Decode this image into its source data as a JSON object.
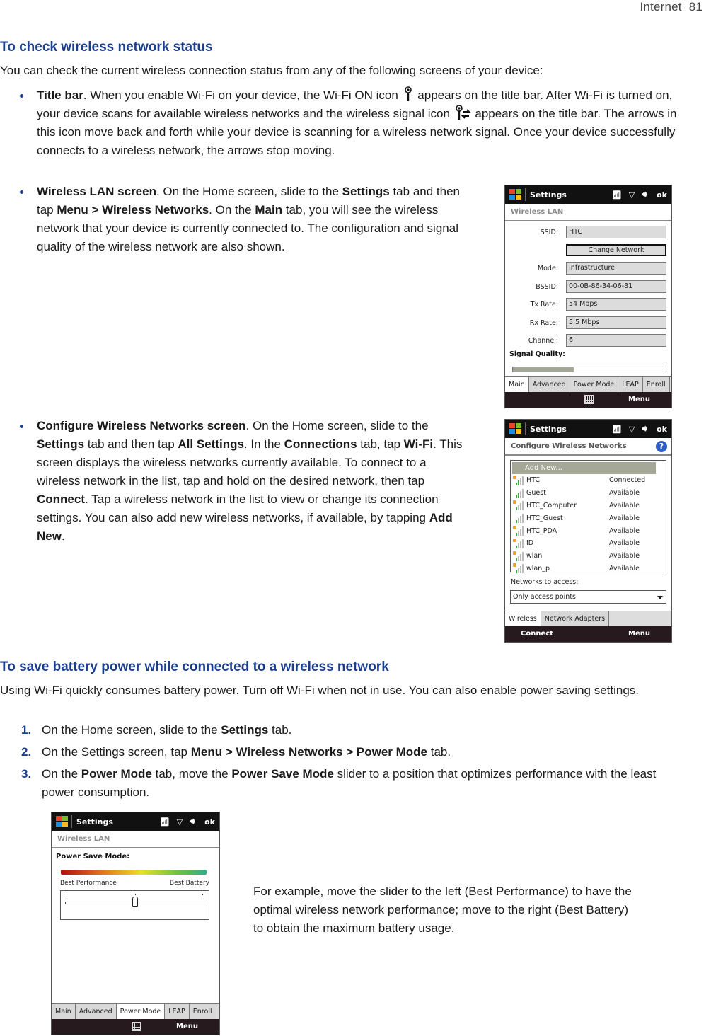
{
  "running_head": {
    "section": "Internet",
    "page": "81"
  },
  "section1": {
    "heading": "To check wireless network status",
    "intro": "You can check the current wireless connection status from any of the following screens of your device:",
    "bullets": [
      {
        "title": "Title bar",
        "text_a": ". When you enable Wi-Fi on your device, the Wi-Fi ON icon ",
        "text_b": " appears on the title bar. After Wi-Fi is turned on, your device scans for available wireless networks and the wireless signal icon ",
        "text_c": " appears on the title bar. The arrows in this icon move back and forth while your device is scanning for a wireless network signal. Once your device successfully connects to a wireless network, the arrows stop moving."
      },
      {
        "title": "Wireless LAN screen",
        "parts": [
          ". On the Home screen, slide to the ",
          "Settings",
          " tab and then tap ",
          "Menu > Wireless Networks",
          ". On the ",
          "Main",
          " tab, you will see the wireless network that your device is currently connected to. The configuration and signal quality of the wireless network are also shown."
        ]
      },
      {
        "title": "Configure Wireless Networks screen",
        "parts": [
          ". On the Home screen, slide to the ",
          "Settings",
          " tab and then tap ",
          "All Settings",
          ". In the ",
          "Connections",
          " tab, tap ",
          "Wi-Fi",
          ". This screen displays the wireless networks currently available. To connect to a wireless network in the list, tap and hold on the desired network, then tap ",
          "Connect",
          ". Tap a wireless network in the list to view or change its connection settings. You can also add new wireless networks, if available, by tapping ",
          "Add New",
          "."
        ]
      }
    ]
  },
  "section2": {
    "heading": "To save battery power while connected to a wireless network",
    "intro": "Using Wi-Fi quickly consumes battery power. Turn off Wi-Fi when not in use. You can also enable power saving settings.",
    "steps": [
      {
        "num": "1.",
        "parts": [
          "On the Home screen, slide to the ",
          "Settings",
          " tab."
        ]
      },
      {
        "num": "2.",
        "parts": [
          "On the Settings screen, tap ",
          "Menu > Wireless Networks > Power Mode",
          " tab."
        ]
      },
      {
        "num": "3.",
        "parts": [
          "On the ",
          "Power Mode",
          " tab, move the ",
          "Power Save Mode",
          " slider to a position that optimizes performance with the least power consumption."
        ]
      }
    ],
    "example": "For example, move the slider to the left (Best Performance) to have the optimal wireless network performance; move to the right (Best Battery) to obtain the maximum battery usage."
  },
  "phone_common": {
    "title": "Settings",
    "ok": "ok",
    "menu": "Menu",
    "icons": [
      "wifi-scan-icon",
      "signal-icon",
      "volume-icon"
    ]
  },
  "wlan_screen": {
    "subheader": "Wireless LAN",
    "fields": [
      {
        "label": "SSID:",
        "value": "HTC"
      },
      {
        "label": "Mode:",
        "value": "Infrastructure"
      },
      {
        "label": "BSSID:",
        "value": "00-0B-86-34-06-81"
      },
      {
        "label": "Tx Rate:",
        "value": "54 Mbps"
      },
      {
        "label": "Rx Rate:",
        "value": "5.5 Mbps"
      },
      {
        "label": "Channel:",
        "value": "6"
      }
    ],
    "change_network": "Change Network",
    "signal_label": "Signal Quality:",
    "signal_quality": 0.4,
    "tabs": [
      "Main",
      "Advanced",
      "Power Mode",
      "LEAP",
      "Enroll"
    ],
    "active_tab": "Main"
  },
  "cwn_screen": {
    "subheader": "Configure Wireless Networks",
    "add_new": "Add New...",
    "networks": [
      {
        "name": "HTC",
        "status": "Connected",
        "secured": true,
        "bars": 2
      },
      {
        "name": "Guest",
        "status": "Available",
        "secured": false,
        "bars": 2
      },
      {
        "name": "HTC_Computer",
        "status": "Available",
        "secured": true,
        "bars": 1
      },
      {
        "name": "HTC_Guest",
        "status": "Available",
        "secured": false,
        "bars": 1
      },
      {
        "name": "HTC_PDA",
        "status": "Available",
        "secured": true,
        "bars": 1
      },
      {
        "name": "ID",
        "status": "Available",
        "secured": true,
        "bars": 1
      },
      {
        "name": "wlan",
        "status": "Available",
        "secured": true,
        "bars": 1
      },
      {
        "name": "wlan_p",
        "status": "Available",
        "secured": true,
        "bars": 1
      }
    ],
    "access_label": "Networks to access:",
    "access_value": "Only access points",
    "tabs": [
      "Wireless",
      "Network Adapters"
    ],
    "active_tab": "Wireless",
    "left_softkey": "Connect"
  },
  "power_screen": {
    "subheader": "Wireless LAN",
    "ps_label": "Power Save Mode:",
    "left_end": "Best Performance",
    "right_end": "Best Battery",
    "slider_position": 0.5,
    "tabs": [
      "Main",
      "Advanced",
      "Power Mode",
      "LEAP",
      "Enroll"
    ],
    "active_tab": "Power Mode"
  }
}
